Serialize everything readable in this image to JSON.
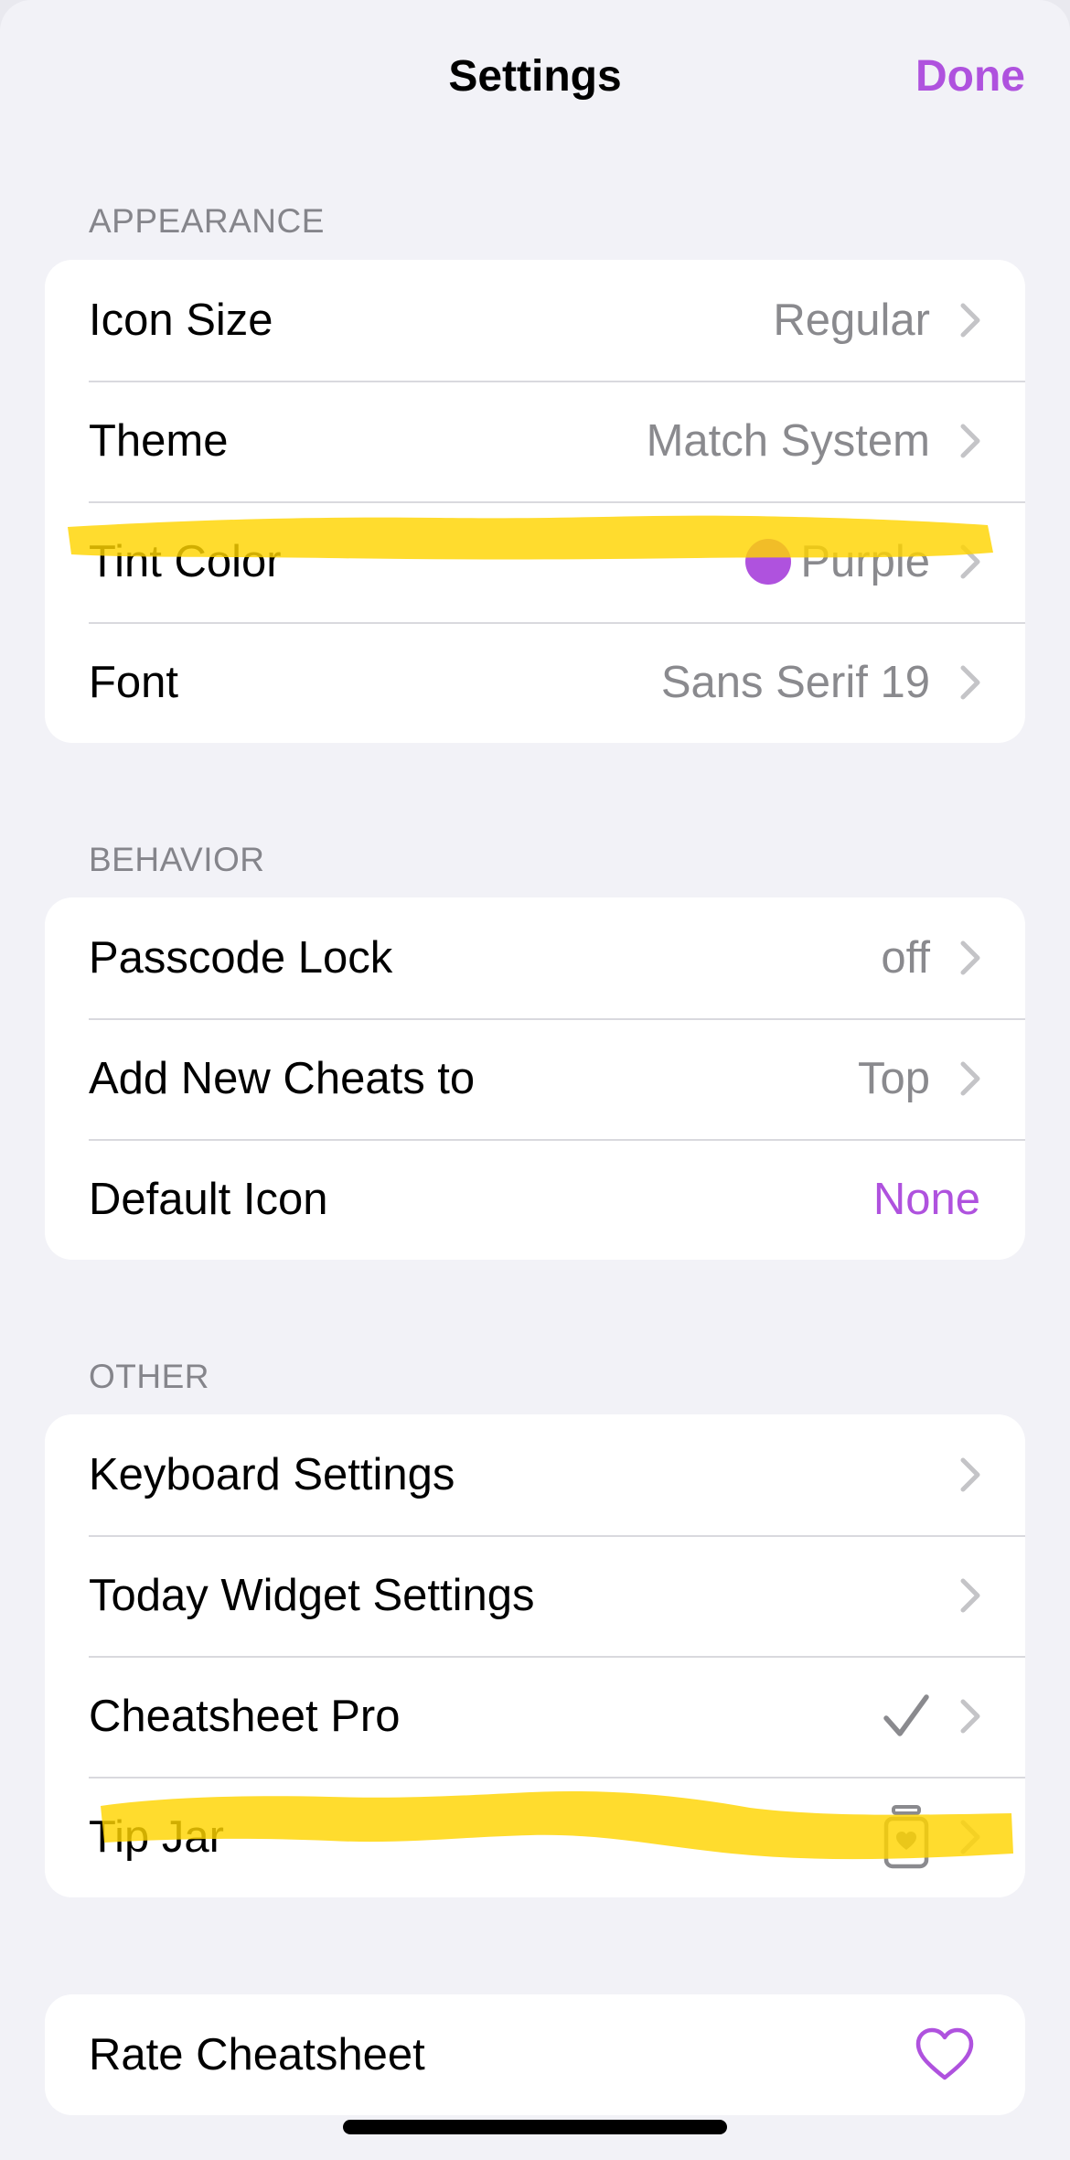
{
  "nav": {
    "title": "Settings",
    "done_label": "Done"
  },
  "accent_color": "#af52de",
  "sections": {
    "appearance": {
      "header": "APPEARANCE",
      "rows": [
        {
          "label": "Icon Size",
          "value": "Regular"
        },
        {
          "label": "Theme",
          "value": "Match System"
        },
        {
          "label": "Tint Color",
          "value": "Purple",
          "swatch_color": "#af52de"
        },
        {
          "label": "Font",
          "value": "Sans Serif 19"
        }
      ]
    },
    "behavior": {
      "header": "BEHAVIOR",
      "rows": [
        {
          "label": "Passcode Lock",
          "value": "off"
        },
        {
          "label": "Add New Cheats to",
          "value": "Top"
        },
        {
          "label": "Default Icon",
          "value": "None"
        }
      ]
    },
    "other": {
      "header": "OTHER",
      "rows": [
        {
          "label": "Keyboard Settings"
        },
        {
          "label": "Today Widget Settings"
        },
        {
          "label": "Cheatsheet Pro",
          "icon": "checkmark-icon"
        },
        {
          "label": "Tip Jar",
          "icon": "tip-jar-icon"
        }
      ]
    },
    "rate": {
      "rows": [
        {
          "label": "Rate Cheatsheet",
          "icon": "heart-icon"
        }
      ]
    }
  },
  "annotations": {
    "highlight_color": "#ffd400"
  }
}
